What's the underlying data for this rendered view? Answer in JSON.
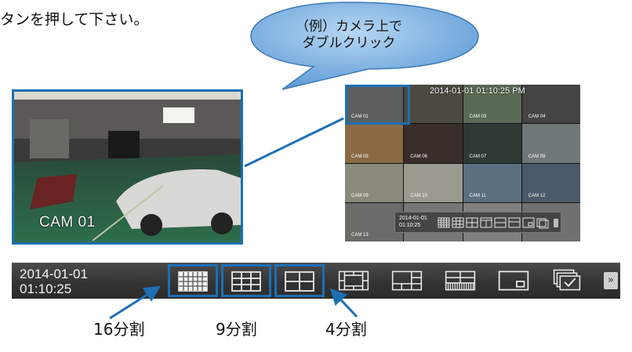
{
  "instruction_text": "タンを押して下さい。",
  "callout": {
    "line1": "（例）カメラ上で",
    "line2": "ダブルクリック"
  },
  "large_view": {
    "camera_label": "CAM 01"
  },
  "grid_view": {
    "timestamp": "2014-01-01 01:10:25 PM",
    "cells": [
      {
        "label": "CAM 01"
      },
      {
        "label": ""
      },
      {
        "label": "CAM 03"
      },
      {
        "label": "CAM 04"
      },
      {
        "label": "CAM 05"
      },
      {
        "label": "CAM 06"
      },
      {
        "label": "CAM 07"
      },
      {
        "label": "CAM 08"
      },
      {
        "label": "CAM 09"
      },
      {
        "label": "CAM 10"
      },
      {
        "label": "CAM 11"
      },
      {
        "label": "CAM 12"
      },
      {
        "label": "CAM 13"
      },
      {
        "label": ""
      },
      {
        "label": ""
      },
      {
        "label": ""
      }
    ],
    "mini_toolbar": {
      "date": "2014-01-01",
      "time": "01:10:25"
    }
  },
  "toolbar": {
    "date": "2014-01-01",
    "time": "01:10:25",
    "buttons": [
      {
        "icon": "split-16-icon"
      },
      {
        "icon": "split-9-icon"
      },
      {
        "icon": "split-4-icon"
      },
      {
        "icon": "split-8-icon"
      },
      {
        "icon": "split-6-icon"
      },
      {
        "icon": "split-13-icon"
      },
      {
        "icon": "pip-icon"
      },
      {
        "icon": "sequence-icon"
      }
    ],
    "next_label": "»"
  },
  "split_labels": {
    "s16": "16分割",
    "s9": "9分割",
    "s4": "4分割"
  },
  "colors": {
    "highlight": "#1d6fb4",
    "bubble_fill": "#6aa8df",
    "toolbar_bg": "#3a3a3a"
  }
}
